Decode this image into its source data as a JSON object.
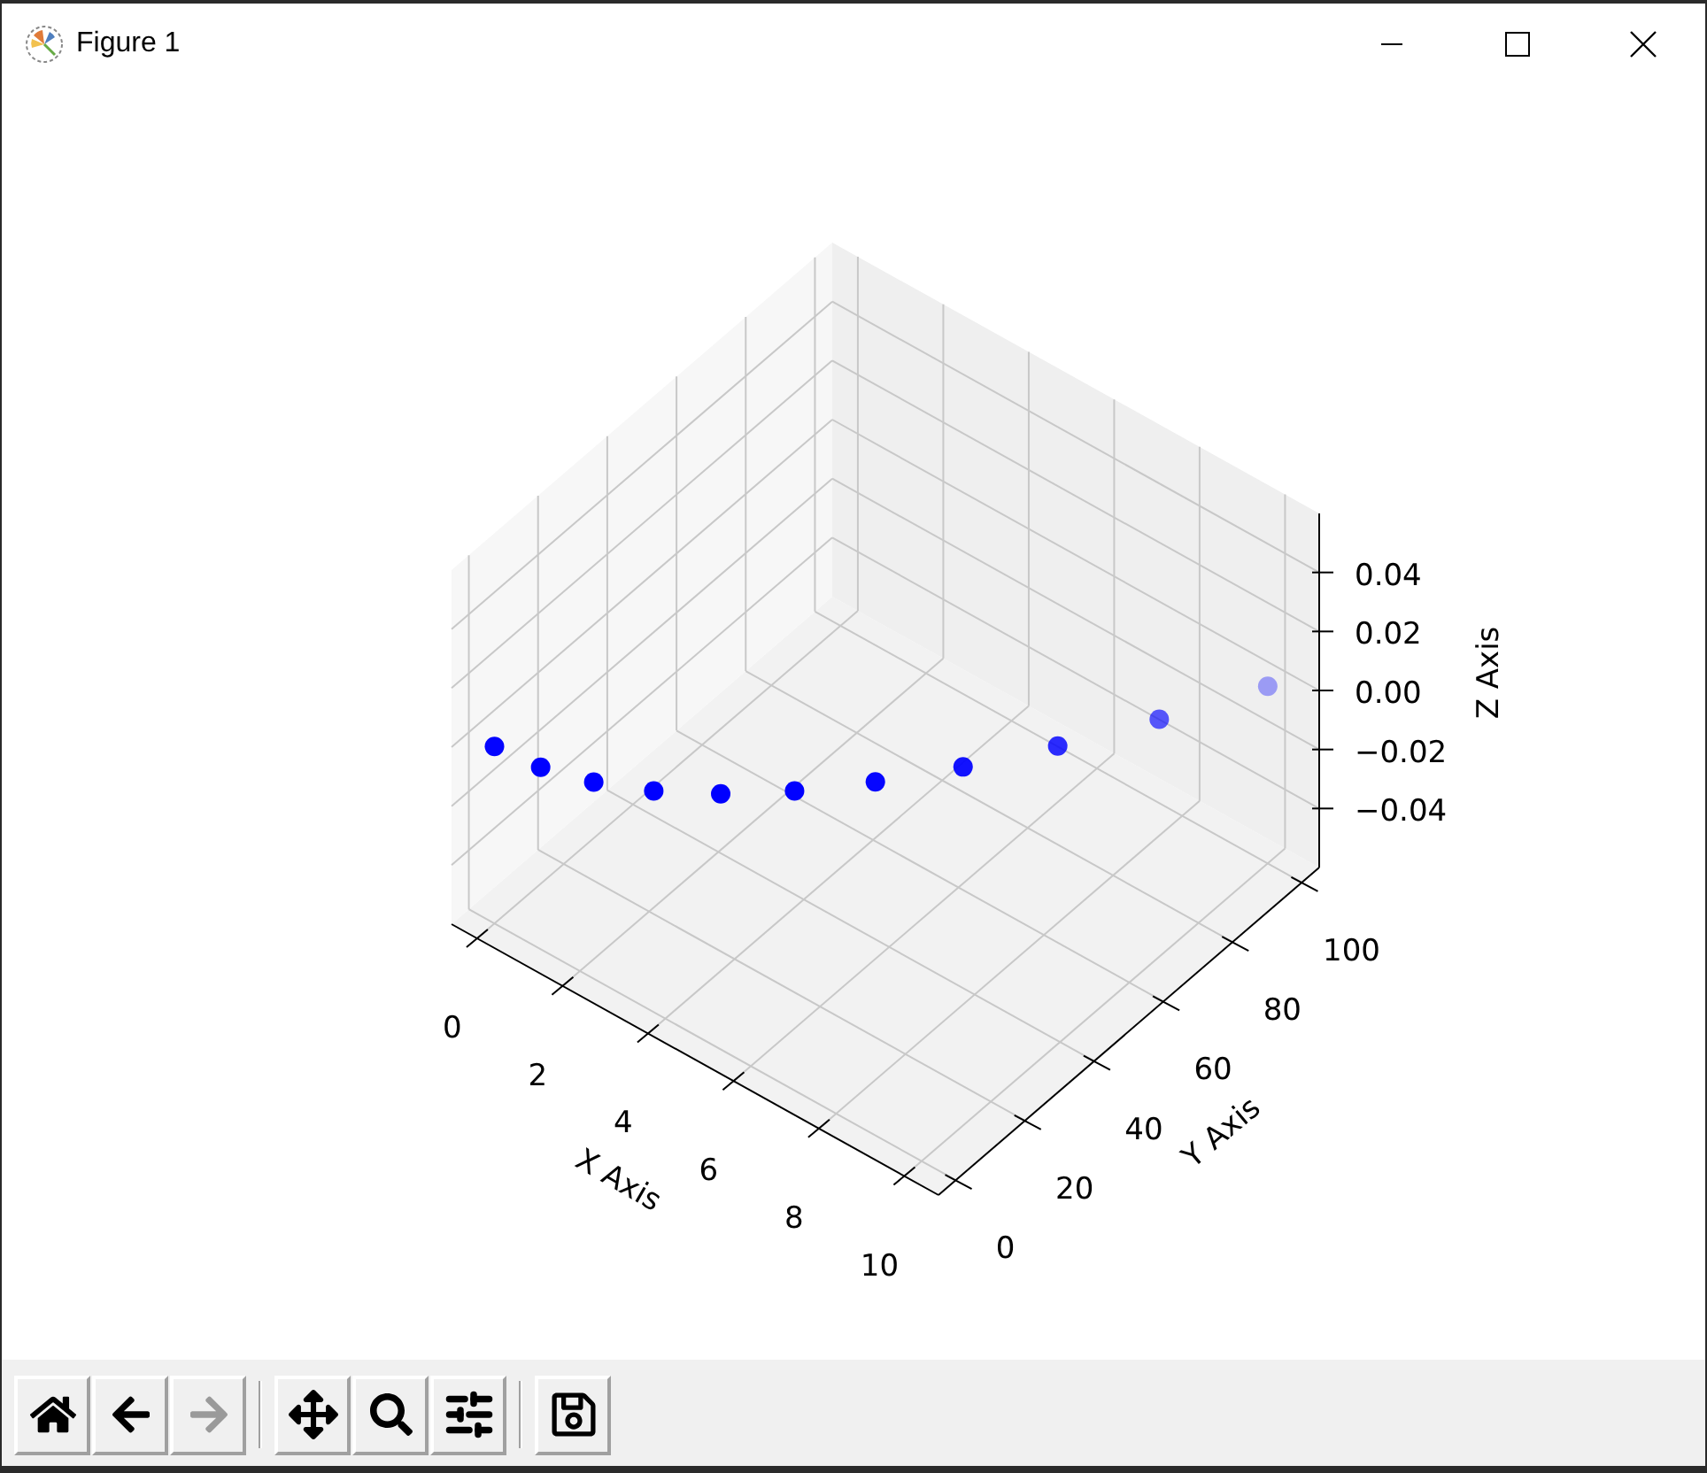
{
  "window": {
    "title": "Figure 1"
  },
  "plot": {
    "x_axis": {
      "label": "X Axis",
      "ticks": [
        "0",
        "2",
        "4",
        "6",
        "8",
        "10"
      ]
    },
    "y_axis": {
      "label": "Y Axis",
      "ticks": [
        "0",
        "20",
        "40",
        "60",
        "80",
        "100"
      ]
    },
    "z_axis": {
      "label": "Z Axis",
      "ticks": [
        "0.04",
        "0.02",
        "0.00",
        "−0.02",
        "−0.04"
      ]
    }
  },
  "toolbar": {
    "groups": [
      [
        {
          "kind": "home",
          "disabled": false
        },
        {
          "kind": "back",
          "disabled": false
        },
        {
          "kind": "forward",
          "disabled": true
        }
      ],
      [
        {
          "kind": "pan",
          "disabled": false
        },
        {
          "kind": "zoom",
          "disabled": false
        },
        {
          "kind": "configure",
          "disabled": false
        }
      ],
      [
        {
          "kind": "save",
          "disabled": false
        }
      ]
    ]
  }
}
